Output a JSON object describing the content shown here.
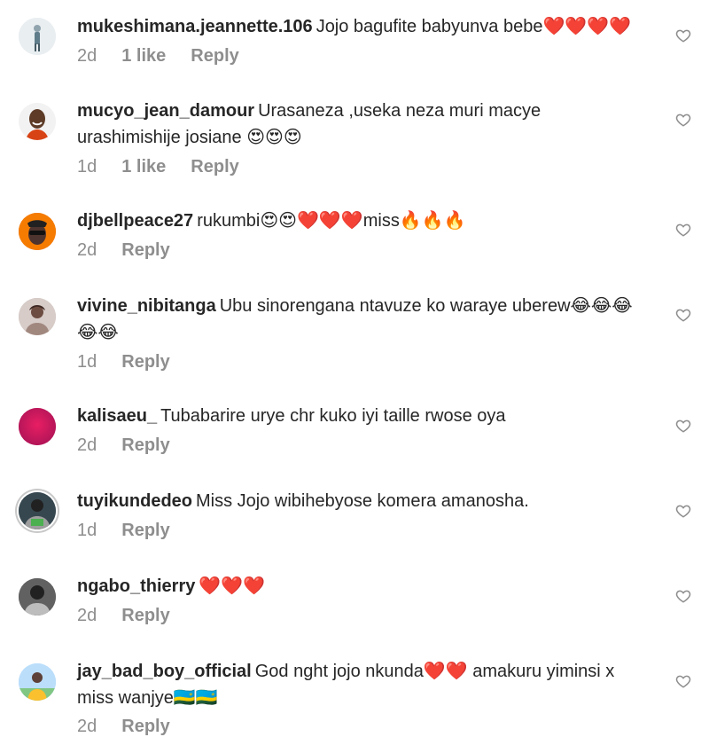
{
  "comments": [
    {
      "username": "mukeshimana.jeannette.106",
      "text": "Jojo bagufite babyunva bebe❤️❤️❤️❤️",
      "time": "2d",
      "likes": "1 like",
      "reply": "Reply",
      "avatar_color": "#cfd8dc",
      "avatar_icon": "person-standing-avatar"
    },
    {
      "username": "mucyo_jean_damour",
      "text": "Urasaneza ,useka neza muri macye  urashimishije josiane 😍😍😍",
      "time": "1d",
      "likes": "1 like",
      "reply": "Reply",
      "avatar_color": "#3e2a1e",
      "avatar_icon": "man-smiling-avatar"
    },
    {
      "username": "djbellpeace27",
      "text": "rukumbi😍😍❤️❤️❤️miss🔥🔥🔥",
      "time": "2d",
      "likes": "",
      "reply": "Reply",
      "avatar_color": "#e65100",
      "avatar_icon": "cartoon-man-avatar"
    },
    {
      "username": "vivine_nibitanga",
      "text": "Ubu sinorengana ntavuze ko waraye uberew😂😂😂😂😂",
      "time": "1d",
      "likes": "",
      "reply": "Reply",
      "avatar_color": "#8d6e63",
      "avatar_icon": "woman-avatar"
    },
    {
      "username": "kalisaeu_",
      "text": "Tubabarire urye chr kuko iyi taille rwose oya",
      "time": "2d",
      "likes": "",
      "reply": "Reply",
      "avatar_color": "#c2185b",
      "avatar_icon": "solid-pink-avatar"
    },
    {
      "username": "tuyikundedeo",
      "text": "Miss Jojo wibihebyose komera amanosha.",
      "time": "1d",
      "likes": "",
      "reply": "Reply",
      "avatar_color": "#455a64",
      "avatar_icon": "man-dark-avatar"
    },
    {
      "username": "ngabo_thierry",
      "text": "❤️❤️❤️",
      "time": "2d",
      "likes": "",
      "reply": "Reply",
      "avatar_color": "#424242",
      "avatar_icon": "man-grayscale-avatar"
    },
    {
      "username": "jay_bad_boy_official",
      "text": "God nght jojo nkunda❤️❤️ amakuru yiminsi x miss wanjye🇷🇼🇷🇼",
      "time": "2d",
      "likes": "",
      "reply": "Reply",
      "avatar_color": "#90caf9",
      "avatar_icon": "man-outdoor-avatar"
    }
  ]
}
